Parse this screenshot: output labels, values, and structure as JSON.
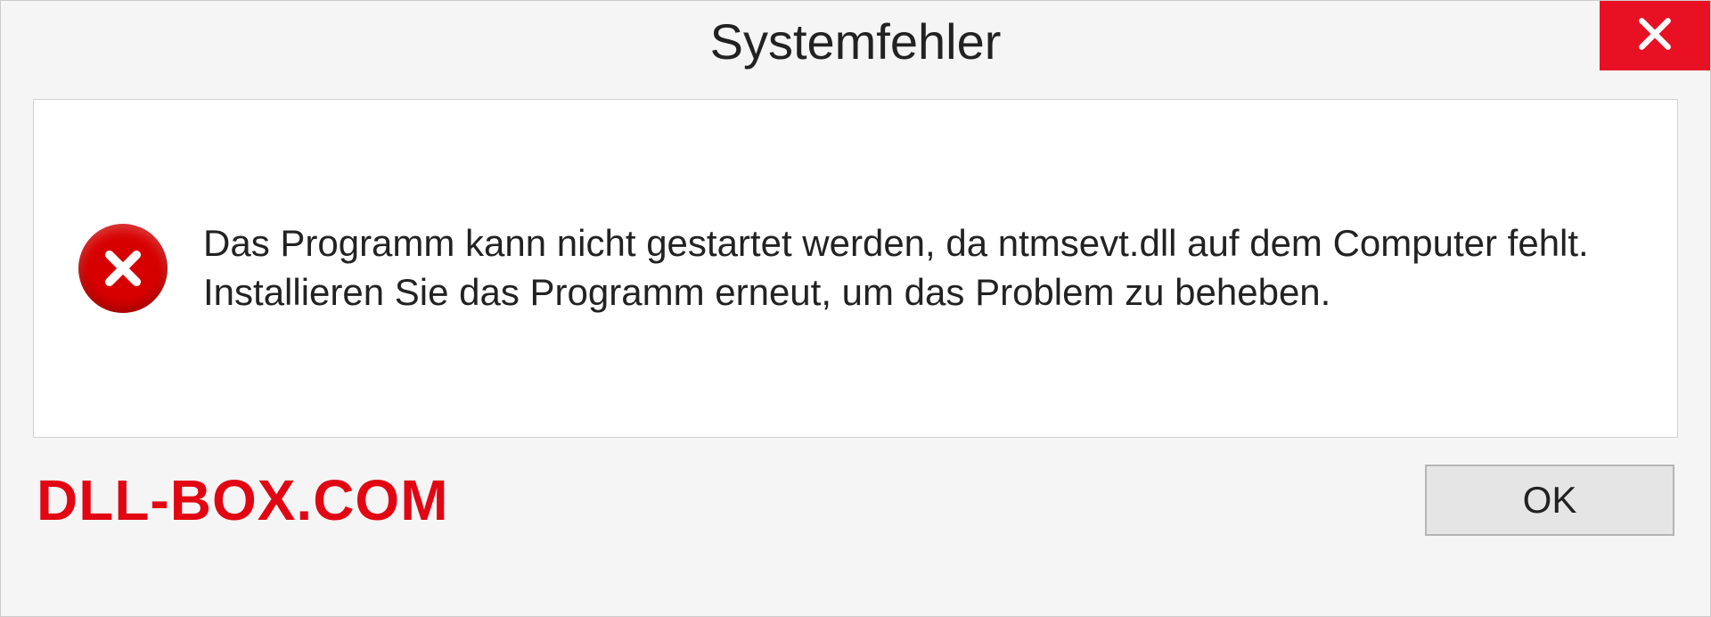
{
  "dialog": {
    "title": "Systemfehler",
    "message": "Das Programm kann nicht gestartet werden, da ntmsevt.dll auf dem Computer fehlt. Installieren Sie das Programm erneut, um das Problem zu beheben.",
    "ok_label": "OK"
  },
  "watermark": {
    "text": "DLL-BOX.COM"
  }
}
